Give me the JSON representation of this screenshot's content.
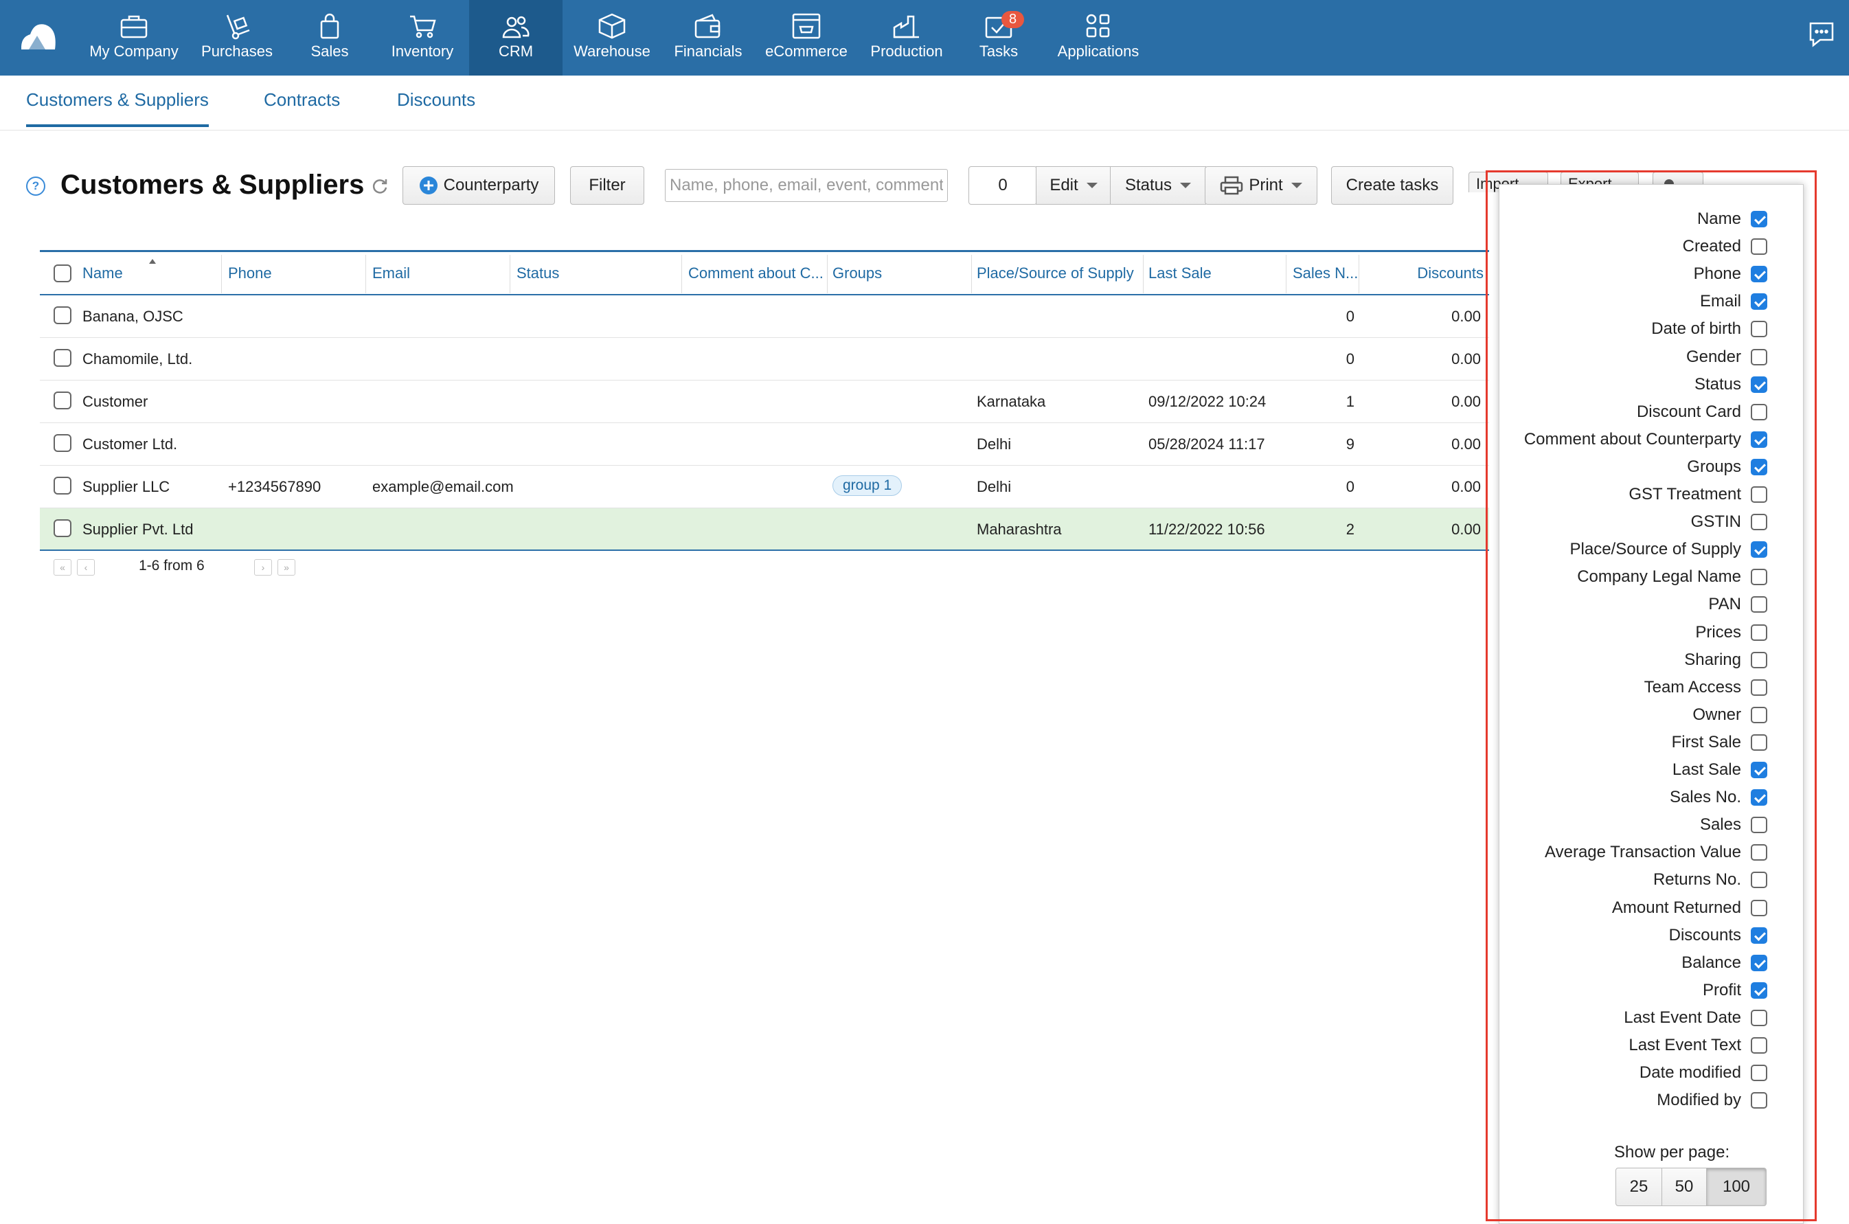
{
  "topnav": {
    "items": [
      {
        "label": "My Company",
        "icon": "briefcase-icon"
      },
      {
        "label": "Purchases",
        "icon": "hand-truck-icon"
      },
      {
        "label": "Sales",
        "icon": "shopping-bag-icon"
      },
      {
        "label": "Inventory",
        "icon": "cart-icon"
      },
      {
        "label": "CRM",
        "icon": "users-icon"
      },
      {
        "label": "Warehouse",
        "icon": "box-icon"
      },
      {
        "label": "Financials",
        "icon": "wallet-icon"
      },
      {
        "label": "eCommerce",
        "icon": "storefront-icon"
      },
      {
        "label": "Production",
        "icon": "factory-icon"
      },
      {
        "label": "Tasks",
        "icon": "check-envelope-icon",
        "badge": "8"
      },
      {
        "label": "Applications",
        "icon": "apps-grid-icon"
      }
    ],
    "active": "CRM"
  },
  "subnav": {
    "tabs": [
      "Customers & Suppliers",
      "Contracts",
      "Discounts"
    ],
    "active": "Customers & Suppliers"
  },
  "toolbar": {
    "title": "Customers & Suppliers",
    "help": "?",
    "counterparty": "Counterparty",
    "filter": "Filter",
    "search_placeholder": "Name, phone, email, event, comment",
    "selected_count": "0",
    "edit": "Edit",
    "status": "Status",
    "print": "Print",
    "create_tasks": "Create tasks",
    "import": "Import",
    "export": "Export"
  },
  "table": {
    "columns": [
      "Name",
      "Phone",
      "Email",
      "Status",
      "Comment about C...",
      "Groups",
      "Place/Source of Supply",
      "Last Sale",
      "Sales N...",
      "Discounts"
    ],
    "rows": [
      {
        "name": "Banana, OJSC",
        "phone": "",
        "email": "",
        "group": "",
        "place": "",
        "last_sale": "",
        "sales_no": "0",
        "discounts": "0.00"
      },
      {
        "name": "Chamomile, Ltd.",
        "phone": "",
        "email": "",
        "group": "",
        "place": "",
        "last_sale": "",
        "sales_no": "0",
        "discounts": "0.00"
      },
      {
        "name": "Customer",
        "phone": "",
        "email": "",
        "group": "",
        "place": "Karnataka",
        "last_sale": "09/12/2022 10:24",
        "sales_no": "1",
        "discounts": "0.00"
      },
      {
        "name": "Customer Ltd.",
        "phone": "",
        "email": "",
        "group": "",
        "place": "Delhi",
        "last_sale": "05/28/2024 11:17",
        "sales_no": "9",
        "discounts": "0.00"
      },
      {
        "name": "Supplier LLC",
        "phone": "+1234567890",
        "email": "example@email.com",
        "group": "group 1",
        "place": "Delhi",
        "last_sale": "",
        "sales_no": "0",
        "discounts": "0.00"
      },
      {
        "name": "Supplier Pvt. Ltd",
        "phone": "",
        "email": "",
        "group": "",
        "place": "Maharashtra",
        "last_sale": "11/22/2022 10:56",
        "sales_no": "2",
        "discounts": "0.00"
      }
    ],
    "pager": "1-6 from 6"
  },
  "column_settings": {
    "options": [
      {
        "label": "Name",
        "checked": true
      },
      {
        "label": "Created",
        "checked": false
      },
      {
        "label": "Phone",
        "checked": true
      },
      {
        "label": "Email",
        "checked": true
      },
      {
        "label": "Date of birth",
        "checked": false
      },
      {
        "label": "Gender",
        "checked": false
      },
      {
        "label": "Status",
        "checked": true
      },
      {
        "label": "Discount Card",
        "checked": false
      },
      {
        "label": "Comment about Counterparty",
        "checked": true
      },
      {
        "label": "Groups",
        "checked": true
      },
      {
        "label": "GST Treatment",
        "checked": false
      },
      {
        "label": "GSTIN",
        "checked": false
      },
      {
        "label": "Place/Source of Supply",
        "checked": true
      },
      {
        "label": "Company Legal Name",
        "checked": false
      },
      {
        "label": "PAN",
        "checked": false
      },
      {
        "label": "Prices",
        "checked": false
      },
      {
        "label": "Sharing",
        "checked": false
      },
      {
        "label": "Team Access",
        "checked": false
      },
      {
        "label": "Owner",
        "checked": false
      },
      {
        "label": "First Sale",
        "checked": false
      },
      {
        "label": "Last Sale",
        "checked": true
      },
      {
        "label": "Sales No.",
        "checked": true
      },
      {
        "label": "Sales",
        "checked": false
      },
      {
        "label": "Average Transaction Value",
        "checked": false
      },
      {
        "label": "Returns No.",
        "checked": false
      },
      {
        "label": "Amount Returned",
        "checked": false
      },
      {
        "label": "Discounts",
        "checked": true
      },
      {
        "label": "Balance",
        "checked": true
      },
      {
        "label": "Profit",
        "checked": true
      },
      {
        "label": "Last Event Date",
        "checked": false
      },
      {
        "label": "Last Event Text",
        "checked": false
      },
      {
        "label": "Date modified",
        "checked": false
      },
      {
        "label": "Modified by",
        "checked": false
      }
    ],
    "show_per_page_label": "Show per page:",
    "page_sizes": [
      "25",
      "50",
      "100"
    ],
    "selected_page_size": "100"
  },
  "colors": {
    "nav_bg": "#2a6ea6",
    "nav_active": "#1d5a8c",
    "link": "#1f6aa3",
    "highlight_border": "#e53a2e",
    "selected_row": "#e1f2de",
    "checkbox_on": "#1f7ee0"
  }
}
